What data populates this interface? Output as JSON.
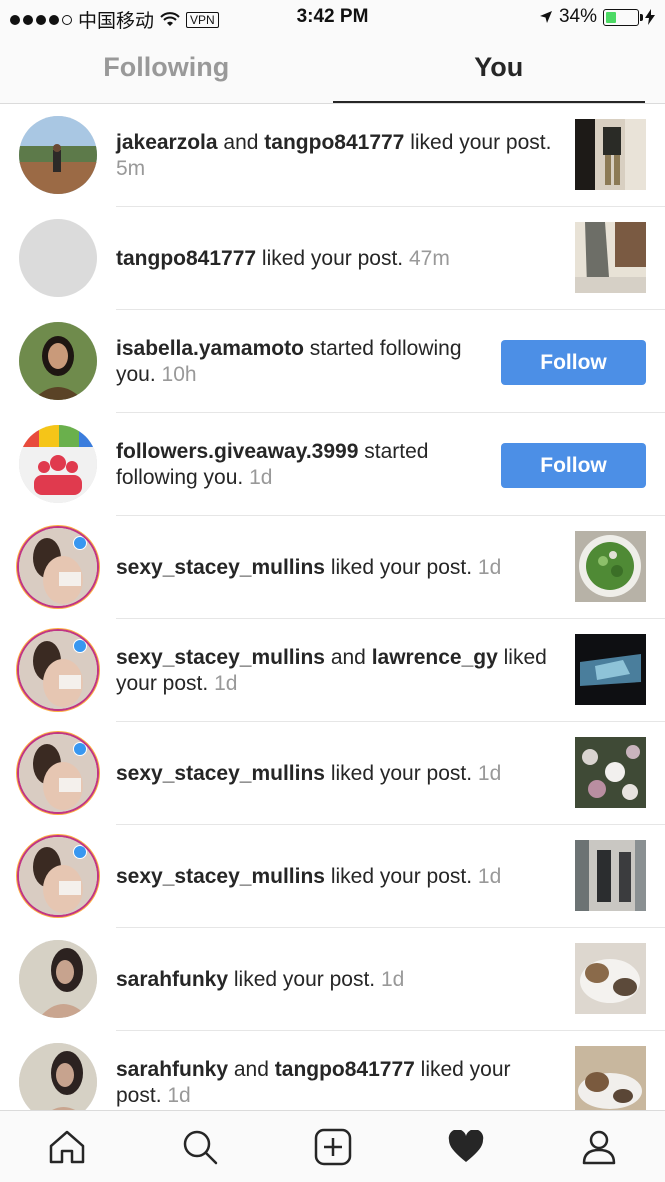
{
  "status_bar": {
    "carrier": "中国移动",
    "vpn": "VPN",
    "time": "3:42 PM",
    "battery": "34%",
    "battery_level": 0.34
  },
  "tabs": [
    {
      "label": "Following",
      "active": false
    },
    {
      "label": "You",
      "active": true
    }
  ],
  "follow_label": "Follow",
  "notifications": [
    {
      "user": "jakearzola",
      "conj": " and ",
      "user2": "tangpo841777",
      "action": " liked your post. ",
      "time": "5m"
    },
    {
      "user": "tangpo841777",
      "action": " liked your post. ",
      "time": "47m"
    },
    {
      "user": "isabella.yamamoto",
      "action": " started following you. ",
      "time": "10h"
    },
    {
      "user": "followers.giveaway.3999",
      "action": " started following you. ",
      "time": "1d"
    },
    {
      "user": "sexy_stacey_mullins",
      "action": " liked your post. ",
      "time": "1d"
    },
    {
      "user": "sexy_stacey_mullins",
      "conj": " and ",
      "user2": "lawrence_gy",
      "action": " liked your post. ",
      "time": "1d"
    },
    {
      "user": "sexy_stacey_mullins",
      "action": " liked your post. ",
      "time": "1d"
    },
    {
      "user": "sexy_stacey_mullins",
      "action": " liked your post. ",
      "time": "1d"
    },
    {
      "user": "sarahfunky",
      "action": " liked your post. ",
      "time": "1d"
    },
    {
      "user": "sarahfunky",
      "conj": " and ",
      "user2": "tangpo841777",
      "action": " liked your post. ",
      "time": "1d"
    }
  ],
  "nav": [
    "home-icon",
    "search-icon",
    "add-post-icon",
    "activity-heart-icon",
    "profile-icon"
  ],
  "colors": {
    "accent": "#4c8fe6",
    "battery": "#4cd964",
    "muted": "#999999"
  }
}
